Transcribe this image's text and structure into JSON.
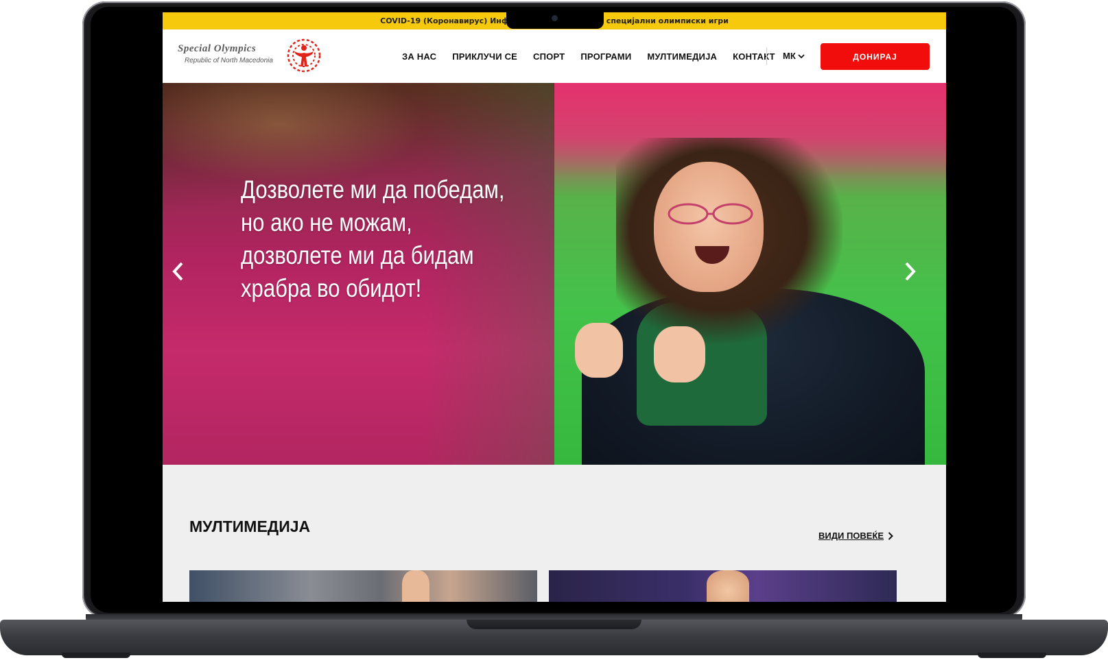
{
  "covid_bar": {
    "text_left": "COVID-19 (Коронавирус) Инф",
    "text_right": "специјални олимписки игри"
  },
  "logo": {
    "title": "Special Olympics",
    "subtitle": "Republic of North Macedonia",
    "mark_color": "#e2231a"
  },
  "nav": {
    "items": [
      "ЗА НАС",
      "ПРИКЛУЧИ СЕ",
      "СПОРТ",
      "ПРОГРАМИ",
      "МУЛТИМЕДИЈА",
      "КОНТАКТ"
    ],
    "language": "МК",
    "donate": "ДОНИРАЈ"
  },
  "hero": {
    "quote_lines": [
      "Дозволете ми да победам,",
      "но ако не можам,",
      "дозволете ми да бидам",
      "храбра во обидот!"
    ]
  },
  "multimedia": {
    "title": "МУЛТИМЕДИЈА",
    "see_more": "ВИДИ ПОВЕЌЕ"
  },
  "colors": {
    "accent_yellow": "#f7c90d",
    "donate_red": "#f20d0d"
  }
}
